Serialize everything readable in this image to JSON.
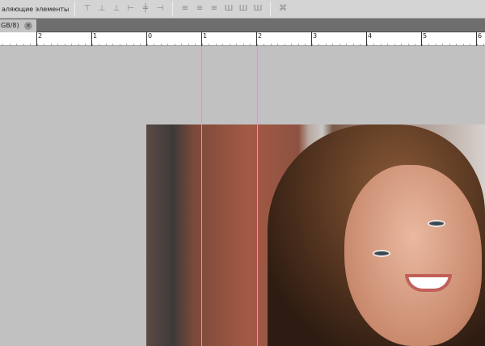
{
  "options_bar": {
    "label": "аляющие элементы",
    "align_icons": [
      "align-top-icon",
      "align-vcenter-icon",
      "align-bottom-icon",
      "align-left-icon",
      "align-hcenter-icon",
      "align-right-icon"
    ],
    "distribute_icons": [
      "distribute-top-icon",
      "distribute-vcenter-icon",
      "distribute-bottom-icon",
      "distribute-left-icon",
      "distribute-hcenter-icon",
      "distribute-right-icon"
    ],
    "auto_align_icon": "auto-align-icon"
  },
  "document_tab": {
    "label": "GB/8)",
    "close": "✕"
  },
  "ruler": {
    "labels": [
      "2",
      "1",
      "0",
      "1",
      "2",
      "3",
      "4",
      "5",
      "6"
    ]
  },
  "colors": {
    "guide": "#3cff5a",
    "canvas": "#c1c1c1"
  }
}
